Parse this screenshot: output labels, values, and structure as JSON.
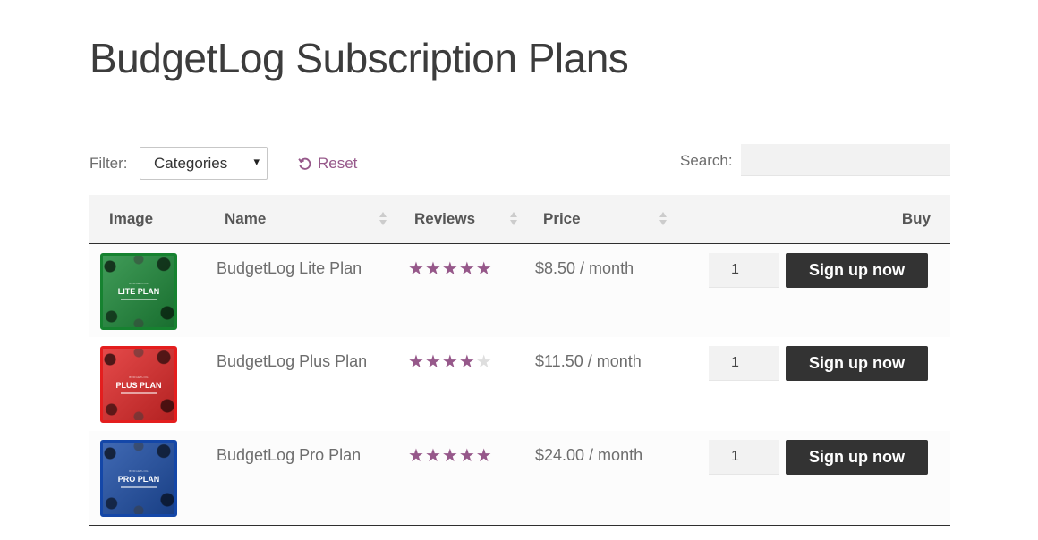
{
  "page": {
    "title": "BudgetLog Subscription Plans"
  },
  "filter": {
    "label": "Filter:",
    "select_value": "Categories",
    "caret": "▾",
    "reset_label": "Reset"
  },
  "search": {
    "label": "Search:",
    "value": ""
  },
  "table": {
    "headers": {
      "image": "Image",
      "name": "Name",
      "reviews": "Reviews",
      "price": "Price",
      "buy": "Buy"
    },
    "rows": [
      {
        "thumb_label": "LITE PLAN",
        "thumb_brand": "BUDGETLOG",
        "thumb_color": "#1f8a3b",
        "thumb_border": "#168230",
        "name": "BudgetLog Lite Plan",
        "rating": 5,
        "price": "$8.50 / month",
        "qty": "1",
        "button": "Sign up now"
      },
      {
        "thumb_label": "PLUS PLAN",
        "thumb_brand": "BUDGETLOG",
        "thumb_color": "#e02a2a",
        "thumb_border": "#e41e1e",
        "name": "BudgetLog Plus Plan",
        "rating": 4,
        "price": "$11.50 / month",
        "qty": "1",
        "button": "Sign up now"
      },
      {
        "thumb_label": "PRO PLAN",
        "thumb_brand": "BUDGETLOG",
        "thumb_color": "#1f4fa6",
        "thumb_border": "#1447a8",
        "name": "BudgetLog Pro Plan",
        "rating": 5,
        "price": "$24.00 / month",
        "qty": "1",
        "button": "Sign up now"
      }
    ]
  },
  "colors": {
    "accent": "#96588a",
    "button_bg": "#333333"
  },
  "icons": {
    "reset": "undo-icon",
    "sort": "sort-arrows-icon",
    "star": "star-icon"
  }
}
